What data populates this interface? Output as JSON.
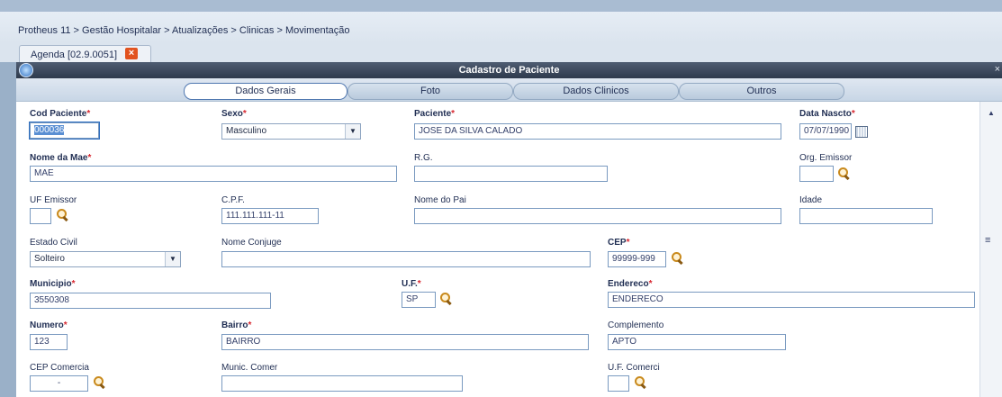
{
  "breadcrumb": "Protheus 11 > Gestão Hospitalar > Atualizações > Clinicas > Movimentação",
  "document_tab": {
    "label": "Agenda [02.9.0051]"
  },
  "window": {
    "title": "Cadastro de Paciente"
  },
  "tabs": [
    {
      "label": "Dados Gerais",
      "active": true
    },
    {
      "label": "Foto",
      "active": false
    },
    {
      "label": "Dados Clinicos",
      "active": false
    },
    {
      "label": "Outros",
      "active": false
    }
  ],
  "required_marker": "*",
  "fields": {
    "cod_paciente": {
      "label": "Cod Paciente",
      "value": "000036"
    },
    "sexo": {
      "label": "Sexo",
      "value": "Masculino"
    },
    "paciente": {
      "label": "Paciente",
      "value": "JOSE DA SILVA CALADO"
    },
    "data_nascto": {
      "label": "Data Nascto",
      "value": "07/07/1990"
    },
    "nome_mae": {
      "label": "Nome da Mae",
      "value": "MAE"
    },
    "rg": {
      "label": "R.G.",
      "value": ""
    },
    "org_emissor": {
      "label": "Org. Emissor",
      "value": ""
    },
    "uf_emissor": {
      "label": "UF Emissor",
      "value": ""
    },
    "cpf": {
      "label": "C.P.F.",
      "value": "111.111.111-11"
    },
    "nome_pai": {
      "label": "Nome do Pai",
      "value": ""
    },
    "idade": {
      "label": "Idade",
      "value": ""
    },
    "estado_civil": {
      "label": "Estado Civil",
      "value": "Solteiro"
    },
    "nome_conjuge": {
      "label": "Nome Conjuge",
      "value": ""
    },
    "cep": {
      "label": "CEP",
      "value": "99999-999"
    },
    "municipio": {
      "label": "Municipio",
      "value": "3550308"
    },
    "uf": {
      "label": "U.F.",
      "value": "SP"
    },
    "endereco": {
      "label": "Endereco",
      "value": "ENDERECO"
    },
    "numero": {
      "label": "Numero",
      "value": "123"
    },
    "bairro": {
      "label": "Bairro",
      "value": "BAIRRO"
    },
    "complemento": {
      "label": "Complemento",
      "value": "APTO"
    },
    "cep_comercial": {
      "label": "CEP Comercia",
      "value": "-"
    },
    "munic_comer": {
      "label": "Munic. Comer",
      "value": ""
    },
    "uf_comerci": {
      "label": "U.F. Comerci",
      "value": ""
    }
  },
  "icons": {
    "close_tab": "close-icon",
    "search": "search-icon",
    "calendar": "calendar-icon",
    "app": "protheus-logo-icon"
  },
  "colors": {
    "required": "#d7262f",
    "titlebar": "#3a4658",
    "close_tab": "#e2531f"
  }
}
